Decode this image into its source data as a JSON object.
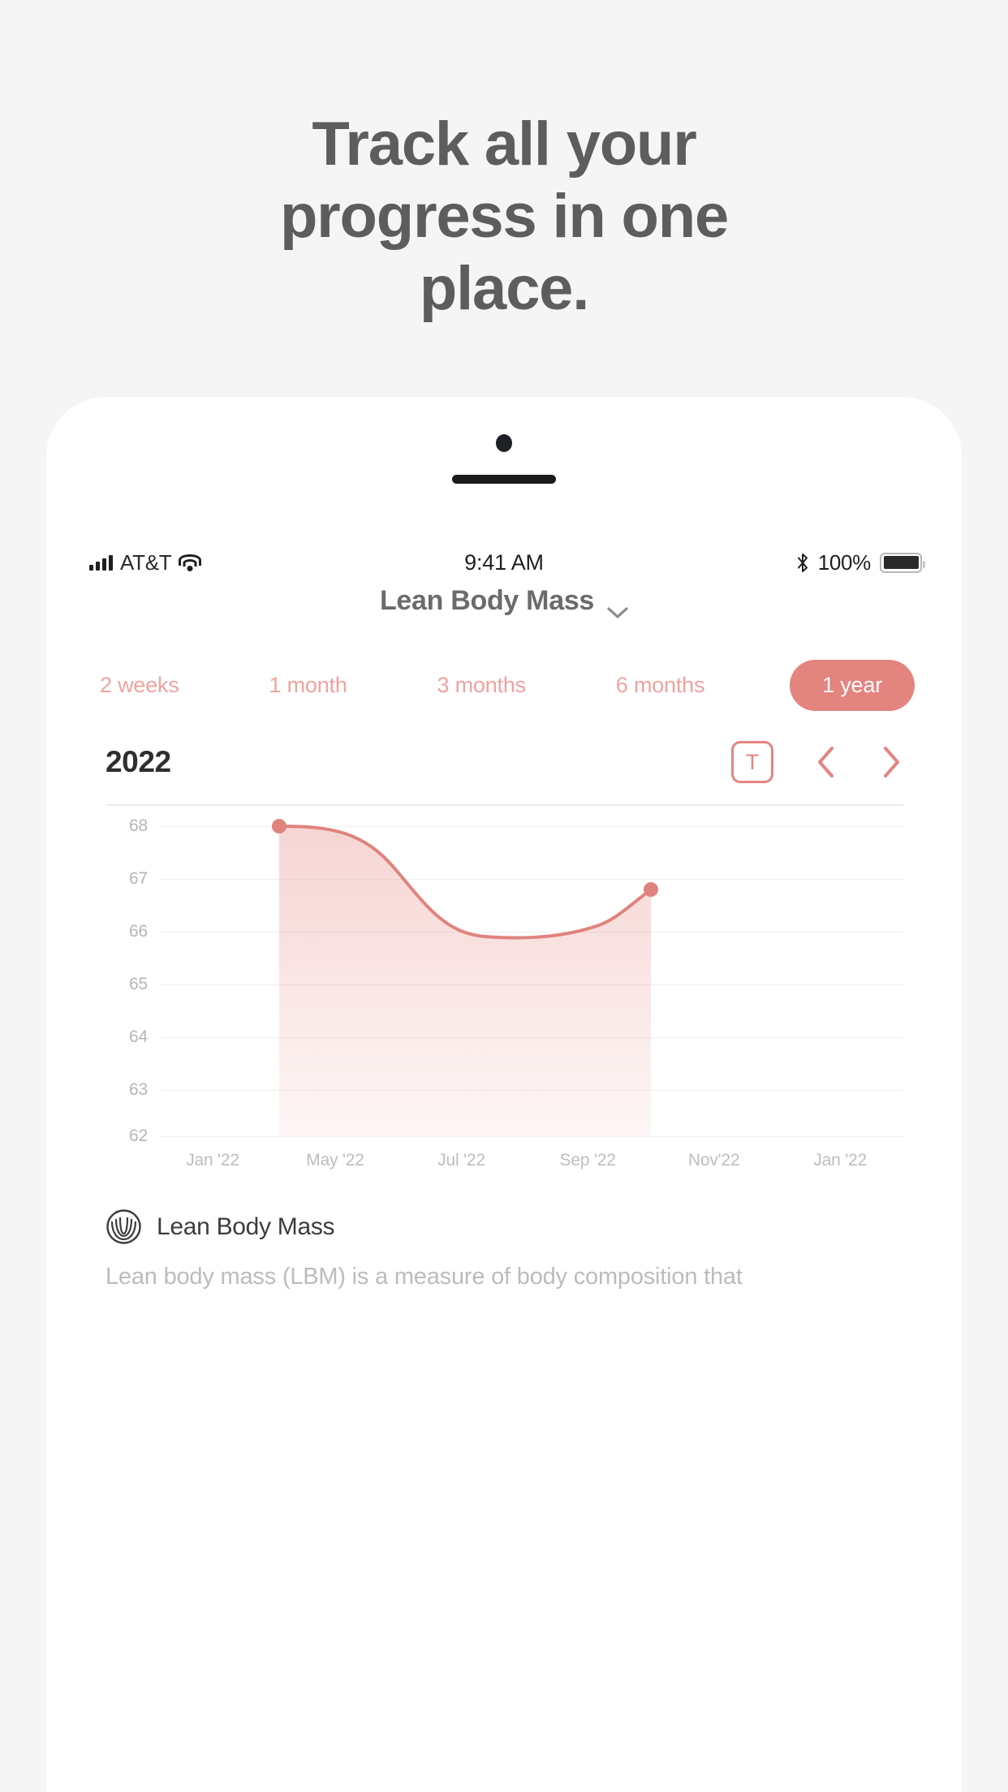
{
  "headline": {
    "lines": [
      "Track all your",
      "progress in one",
      "place."
    ]
  },
  "phone": {
    "statusbar": {
      "carrier": "AT&T",
      "time": "9:41 AM",
      "battery_percent": "100%",
      "signal_icon": "cellular-signal-icon",
      "wifi_icon": "wifi-icon",
      "bluetooth_icon": "bluetooth-icon",
      "battery_icon": "battery-full-icon"
    },
    "app": {
      "title": "Lean Body Mass",
      "title_chevron_icon": "chevron-down-icon",
      "ranges": [
        {
          "label": "2 weeks",
          "active": false
        },
        {
          "label": "1 month",
          "active": false
        },
        {
          "label": "3 months",
          "active": false
        },
        {
          "label": "6 months",
          "active": false
        },
        {
          "label": "1 year",
          "active": true
        }
      ],
      "year": "2022",
      "today_button": "T",
      "prev_icon": "chevron-left-icon",
      "next_icon": "chevron-right-icon",
      "legend": {
        "icon": "lean-body-mass-icon",
        "label": "Lean Body Mass"
      },
      "description": "Lean body mass (LBM) is a measure of body composition that"
    }
  },
  "colors": {
    "accent": "#e4847f",
    "accent_light": "#efa3a0",
    "headline": "#5d5d5d",
    "axis_text": "#b6b6b6",
    "grid": "#f0eeee"
  },
  "chart_data": {
    "type": "area",
    "title": "Lean Body Mass",
    "xlabel": "",
    "ylabel": "",
    "ylim": [
      62,
      68
    ],
    "yticks": [
      68,
      67,
      66,
      65,
      64,
      63,
      62
    ],
    "xticks": [
      "Jan '22",
      "May '22",
      "Jul '22",
      "Sep '22",
      "Nov'22",
      "Jan '22"
    ],
    "grid": true,
    "legend": "Lean Body Mass",
    "series": [
      {
        "name": "Lean Body Mass",
        "x": [
          "Mar '22",
          "Apr '22",
          "May '22",
          "Jun '22",
          "Jul '22",
          "Aug '22",
          "Sep '22",
          "Oct '22"
        ],
        "values": [
          68.0,
          67.9,
          67.5,
          66.7,
          66.2,
          66.1,
          66.2,
          66.8
        ],
        "markers": [
          {
            "x": "Mar '22",
            "y": 68.0
          },
          {
            "x": "Oct '22",
            "y": 66.8
          }
        ]
      }
    ]
  }
}
